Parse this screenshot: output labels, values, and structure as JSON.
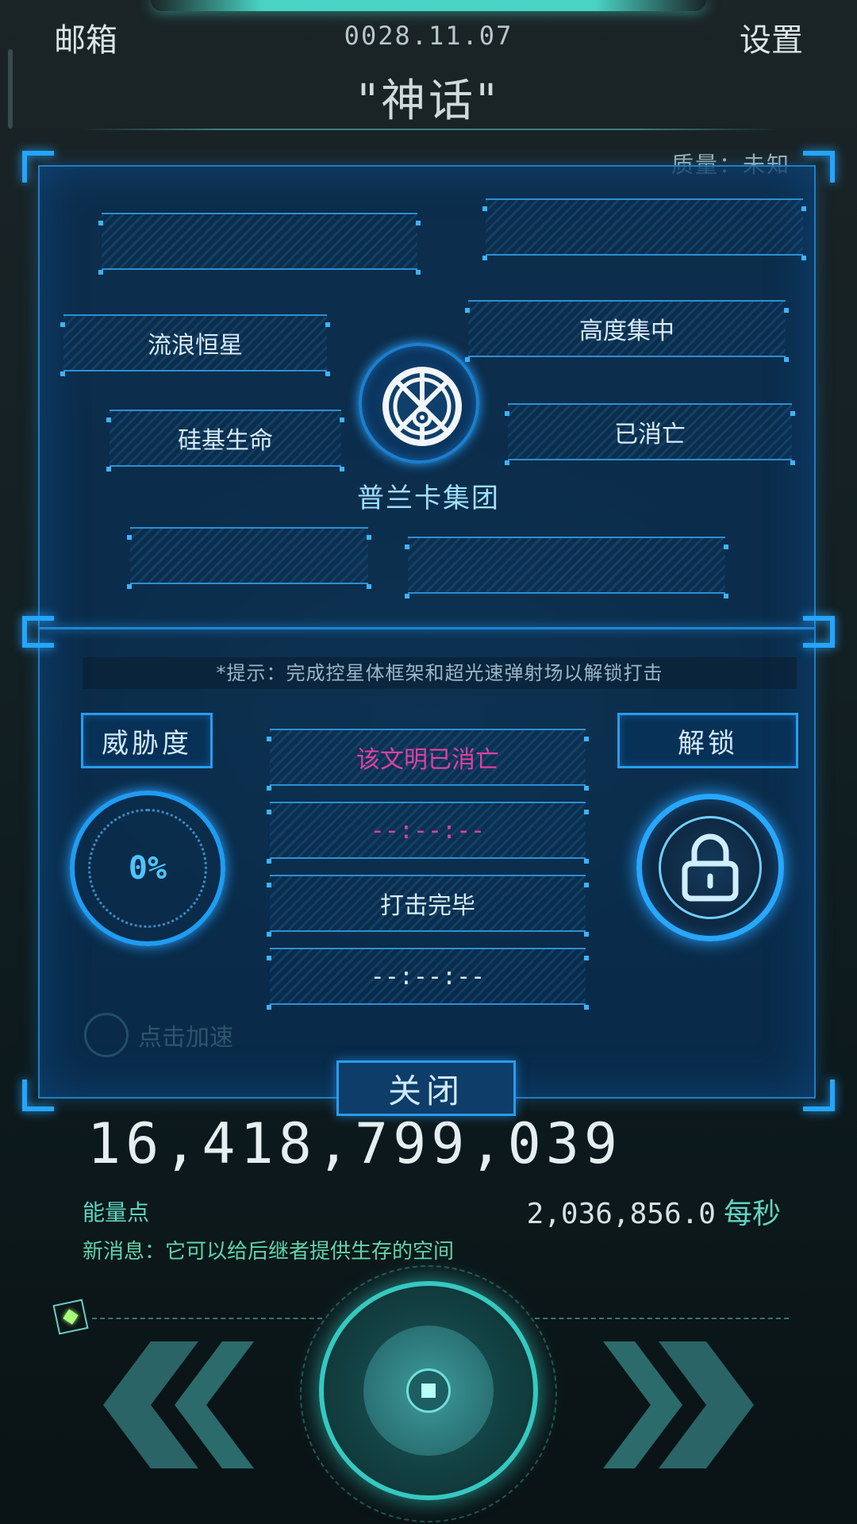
{
  "header": {
    "mail_label": "邮箱",
    "date": "0028.11.07",
    "settings_label": "设置",
    "title": "\"神话\""
  },
  "quality_label": "质量：未知",
  "civilization": {
    "slots": [
      {
        "label": ""
      },
      {
        "label": ""
      },
      {
        "label": "流浪恒星"
      },
      {
        "label": "高度集中"
      },
      {
        "label": "硅基生命"
      },
      {
        "label": "已消亡"
      },
      {
        "label": ""
      },
      {
        "label": ""
      }
    ],
    "emblem_icon": "civilization-emblem-icon",
    "group_name": "普兰卡集团"
  },
  "strike": {
    "hint": "*提示：完成控星体框架和超光速弹射场以解锁打击",
    "threat_label": "威胁度",
    "threat_value": "0%",
    "unlock_label": "解锁",
    "lock_icon": "padlock-icon",
    "status_rows": [
      {
        "text": "该文明已消亡",
        "color": "#e040a0"
      },
      {
        "text": "--:--:--",
        "color": "#e040a0"
      },
      {
        "text": "打击完毕",
        "color": "#d6ecf7"
      },
      {
        "text": "--:--:--",
        "color": "#d6ecf7"
      }
    ],
    "speed_up_label": "点击加速"
  },
  "close_label": "关闭",
  "energy": {
    "value": "16,418,799,039",
    "label": "能量点",
    "rate_value": "2,036,856.0",
    "rate_unit": "每秒"
  },
  "news": "新消息：它可以给后继者提供生存的空间",
  "colors": {
    "accent_blue": "#23a6ff",
    "accent_teal": "#35c9c1",
    "alert_pink": "#e040a0"
  },
  "nav": {
    "prev_icon": "double-chevron-left-icon",
    "next_icon": "double-chevron-right-icon",
    "center_icon": "center-orb-button-icon"
  }
}
